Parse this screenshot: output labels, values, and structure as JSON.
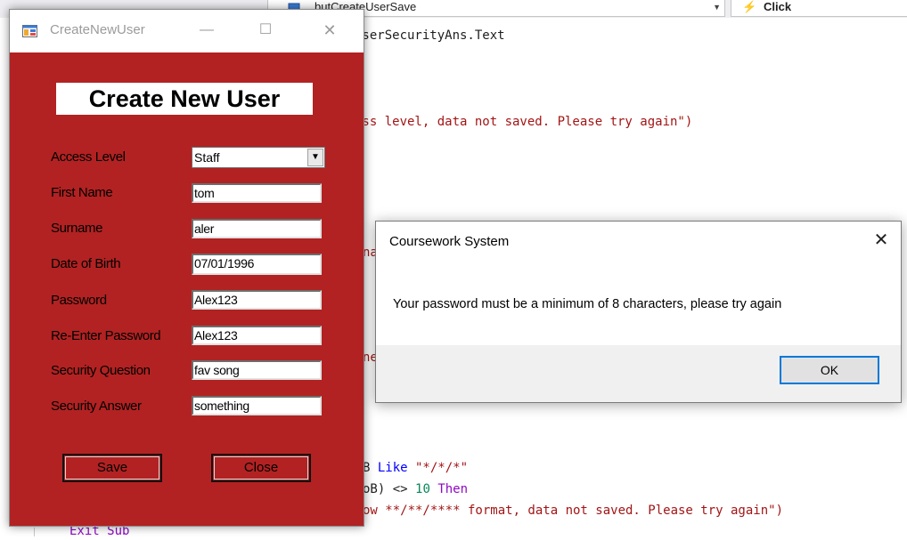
{
  "ide": {
    "object_combo": "butCreateUserSave",
    "event_combo": "Click",
    "code_lines": {
      "l1": "UserSecurityAns.Text",
      "l2": "ess level, data not saved. Please try again\")",
      "l3": "na",
      "l4": "ne_",
      "l5a": "B ",
      "l5b": "Like",
      "l5c": " \"*/*/*\"",
      "l6a": "oB) <> ",
      "l6b": "10",
      "l6c": " ",
      "l6d": "Then",
      "l7": "ow **/**/**** format, data not saved. Please try again\")",
      "l8": "Exit Sub"
    }
  },
  "create_window": {
    "title": "CreateNewUser",
    "form_title": "Create New User",
    "fields": [
      {
        "label": "Access Level",
        "value": "Staff"
      },
      {
        "label": "First Name",
        "value": "tom"
      },
      {
        "label": "Surname",
        "value": "aler"
      },
      {
        "label": "Date of Birth",
        "value": "07/01/1996"
      },
      {
        "label": "Password",
        "value": "Alex123"
      },
      {
        "label": "Re-Enter Password",
        "value": "Alex123"
      },
      {
        "label": "Security Question",
        "value": "fav song"
      },
      {
        "label": "Security Answer",
        "value": "something"
      }
    ],
    "save_label": "Save",
    "close_label": "Close",
    "controls": {
      "minimize": "—",
      "maximize": "☐",
      "close": "✕"
    },
    "background_color": "#b22222"
  },
  "message_box": {
    "title": "Coursework System",
    "message": "Your password must be a minimum of 8 characters, please try again",
    "ok_label": "OK",
    "close_glyph": "✕"
  }
}
